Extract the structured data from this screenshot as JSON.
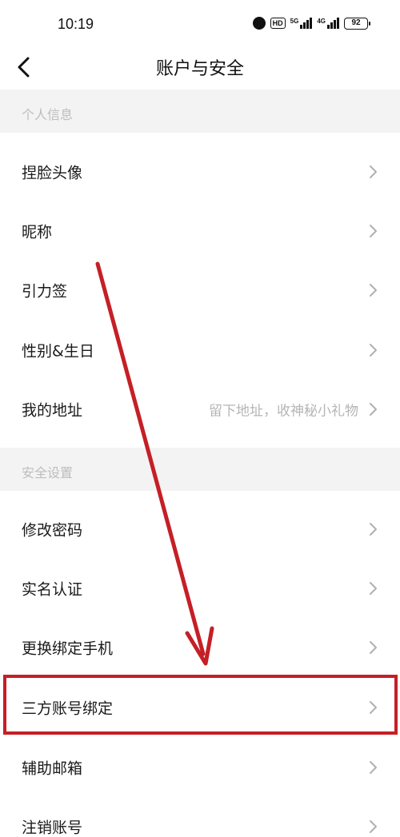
{
  "status_bar": {
    "time": "10:19",
    "hd_label": "HD",
    "net1_label": "5G",
    "net2_label": "4G",
    "battery_level": "92",
    "icons": [
      "alarm-icon",
      "hd-icon",
      "signal-5g-icon",
      "signal-4g-icon",
      "battery-icon"
    ]
  },
  "header": {
    "title": "账户与安全",
    "back_icon": "chevron-left-icon"
  },
  "sections": [
    {
      "header": "个人信息",
      "items": [
        {
          "label": "捏脸头像"
        },
        {
          "label": "昵称"
        },
        {
          "label": "引力签"
        },
        {
          "label": "性别&生日"
        },
        {
          "label": "我的地址",
          "hint": "留下地址，收神秘小礼物"
        }
      ]
    },
    {
      "header": "安全设置",
      "items": [
        {
          "label": "修改密码"
        },
        {
          "label": "实名认证"
        },
        {
          "label": "更换绑定手机"
        },
        {
          "label": "三方账号绑定"
        },
        {
          "label": "辅助邮箱"
        },
        {
          "label": "注销账号"
        }
      ]
    }
  ],
  "colors": {
    "annotation_red": "#c51f26",
    "section_bg": "#f3f3f3",
    "section_text": "#bdbdbd",
    "chevron": "#b0b0b0"
  }
}
